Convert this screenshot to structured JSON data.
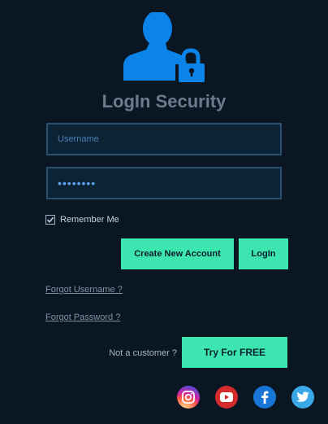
{
  "header": {
    "title": "LogIn Security",
    "logo_icon": "user-lock-icon",
    "logo_color": "#0a84e8"
  },
  "form": {
    "username_placeholder": "Username",
    "username_value": "",
    "password_value": "••••••••",
    "remember_label": "Remember Me",
    "remember_checked": true
  },
  "buttons": {
    "create_account_label": "Create New Account",
    "login_label": "LogIn",
    "try_label": "Try For FREE"
  },
  "links": {
    "forgot_username": "Forgot Username ?",
    "forgot_password": "Forgot Password ?"
  },
  "promo": {
    "not_customer": "Not a customer ?"
  },
  "social": {
    "icons": [
      "instagram-icon",
      "youtube-icon",
      "facebook-icon",
      "twitter-icon"
    ]
  },
  "colors": {
    "background": "#0a1622",
    "accent": "#3de6b0",
    "title": "#6b7c8e",
    "field_border": "#2a5170"
  }
}
